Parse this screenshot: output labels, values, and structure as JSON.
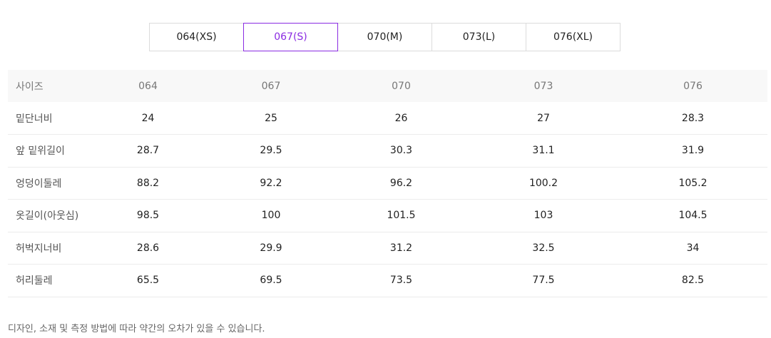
{
  "tabs": [
    {
      "label": "064(XS)",
      "active": false
    },
    {
      "label": "067(S)",
      "active": true
    },
    {
      "label": "070(M)",
      "active": false
    },
    {
      "label": "073(L)",
      "active": false
    },
    {
      "label": "076(XL)",
      "active": false
    }
  ],
  "accent_color": "#8a2be2",
  "table": {
    "header": {
      "label": "사이즈",
      "sizes": [
        "064",
        "067",
        "070",
        "073",
        "076"
      ]
    },
    "rows": [
      {
        "label": "밑단너비",
        "values": [
          "24",
          "25",
          "26",
          "27",
          "28.3"
        ]
      },
      {
        "label": "앞 밑위길이",
        "values": [
          "28.7",
          "29.5",
          "30.3",
          "31.1",
          "31.9"
        ]
      },
      {
        "label": "엉덩이둘레",
        "values": [
          "88.2",
          "92.2",
          "96.2",
          "100.2",
          "105.2"
        ]
      },
      {
        "label": "옷길이(아웃심)",
        "values": [
          "98.5",
          "100",
          "101.5",
          "103",
          "104.5"
        ]
      },
      {
        "label": "허벅지너비",
        "values": [
          "28.6",
          "29.9",
          "31.2",
          "32.5",
          "34"
        ]
      },
      {
        "label": "허리둘레",
        "values": [
          "65.5",
          "69.5",
          "73.5",
          "77.5",
          "82.5"
        ]
      }
    ]
  },
  "note": "디자인, 소재 및 측정 방법에 따라 약간의 오차가 있을 수 있습니다."
}
